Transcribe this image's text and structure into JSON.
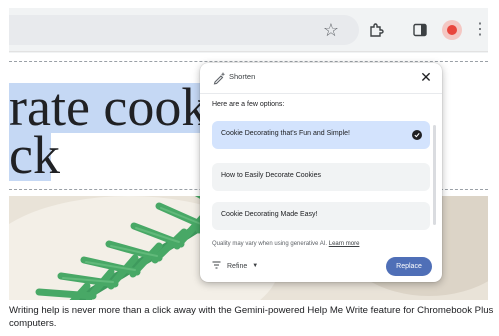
{
  "browser": {
    "icons": {
      "bookmark": "star-icon",
      "extensions": "puzzle-icon",
      "side_panel": "side-panel-icon",
      "profile": "avatar",
      "menu": "kebab-menu-icon"
    }
  },
  "page": {
    "heading_lines": [
      "rate cookie",
      "ck"
    ],
    "highlight_color": "#c5d8f4"
  },
  "dialog": {
    "mode_label": "Shorten",
    "intro": "Here are a few options:",
    "options": [
      {
        "label": "Cookie Decorating that's Fun and Simple!",
        "selected": true
      },
      {
        "label": "How to Easily Decorate Cookies",
        "selected": false
      },
      {
        "label": "Cookie Decorating Made Easy!",
        "selected": false
      }
    ],
    "note": "Quality may vary when using generative AI.",
    "learn_more": "Learn more",
    "refine_label": "Refine",
    "replace_label": "Replace",
    "colors": {
      "selected_option": "#d3e3fd",
      "replace_button": "#4f6fb7"
    }
  },
  "caption": "Writing help is never more than a click away with the Gemini-powered Help Me Write feature for Chromebook Plus computers."
}
